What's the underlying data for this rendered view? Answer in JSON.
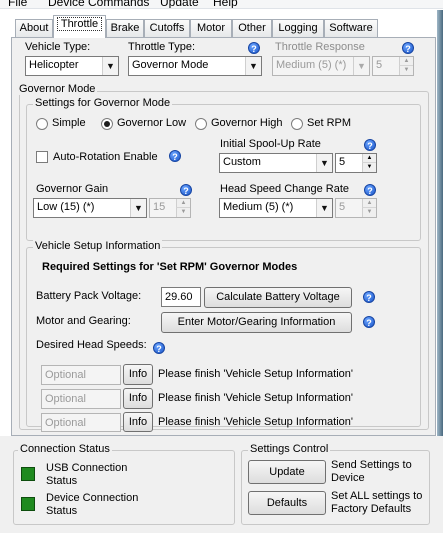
{
  "menu": {
    "items": [
      "File",
      "Device Commands",
      "Update",
      "Help"
    ]
  },
  "tabs": [
    "About",
    "Throttle",
    "Brake",
    "Cutoffs",
    "Motor",
    "Other",
    "Logging",
    "Software"
  ],
  "active_tab": "Throttle",
  "throttle": {
    "vehicle_type_label": "Vehicle Type:",
    "vehicle_type_value": "Helicopter",
    "throttle_type_label": "Throttle Type:",
    "throttle_type_value": "Governor Mode",
    "throttle_response_label": "Throttle Response",
    "throttle_response_value": "Medium (5) (*)",
    "throttle_response_num": "5"
  },
  "governor": {
    "title": "Governor Mode",
    "settings_title": "Settings for Governor Mode",
    "modes": [
      "Simple",
      "Governor Low",
      "Governor High",
      "Set RPM"
    ],
    "selected_mode": "Governor Low",
    "autorotation_label": "Auto-Rotation Enable",
    "spoolup_label": "Initial Spool-Up Rate",
    "spoolup_value": "Custom",
    "spoolup_num": "5",
    "gain_label": "Governor Gain",
    "gain_value": "Low (15) (*)",
    "gain_num": "15",
    "headspeed_label": "Head Speed Change Rate",
    "headspeed_value": "Medium (5) (*)",
    "headspeed_num": "5"
  },
  "vehicle_setup": {
    "title": "Vehicle Setup Information",
    "required_text": "Required Settings for 'Set RPM' Governor Modes",
    "battery_label": "Battery Pack Voltage:",
    "battery_value": "29.60",
    "calc_button": "Calculate Battery Voltage",
    "motor_label": "Motor and Gearing:",
    "motor_button": "Enter Motor/Gearing Information",
    "headspeeds_label": "Desired Head Speeds:",
    "rows": [
      {
        "placeholder": "Optional",
        "info": "Info",
        "note": "Please finish 'Vehicle Setup Information'"
      },
      {
        "placeholder": "Optional",
        "info": "Info",
        "note": "Please finish 'Vehicle Setup Information'"
      },
      {
        "placeholder": "Optional",
        "info": "Info",
        "note": "Please finish 'Vehicle Setup Information'"
      }
    ]
  },
  "connection": {
    "title": "Connection Status",
    "usb": "USB Connection Status",
    "device": "Device Connection Status"
  },
  "settings_control": {
    "title": "Settings Control",
    "update_button": "Update",
    "update_desc": "Send Settings to Device",
    "defaults_button": "Defaults",
    "defaults_desc": "Set ALL settings to Factory Defaults"
  },
  "colors": {
    "status_led": "#1f8a1f",
    "help_icon": "#1b56c9"
  }
}
